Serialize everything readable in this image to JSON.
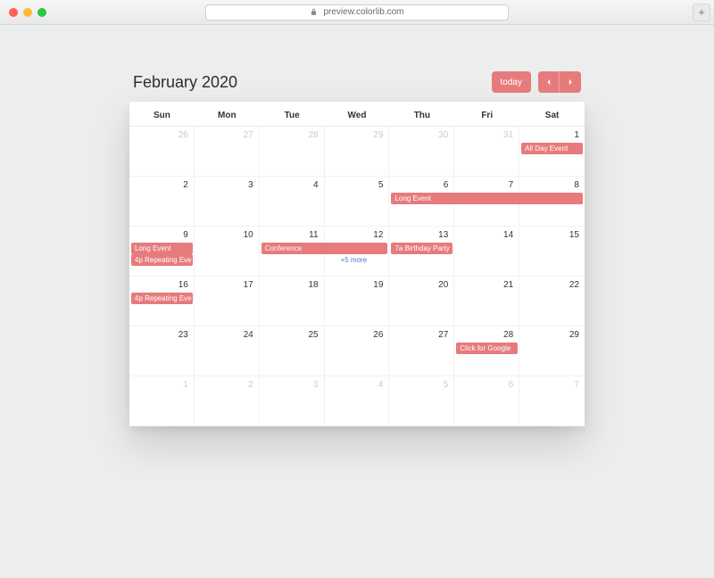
{
  "browser": {
    "url": "preview.colorlib.com"
  },
  "header": {
    "title": "February 2020",
    "today_label": "today"
  },
  "colors": {
    "accent": "#e77b7c"
  },
  "dow": [
    "Sun",
    "Mon",
    "Tue",
    "Wed",
    "Thu",
    "Fri",
    "Sat"
  ],
  "days": [
    {
      "n": "26",
      "other": true
    },
    {
      "n": "27",
      "other": true
    },
    {
      "n": "28",
      "other": true
    },
    {
      "n": "29",
      "other": true
    },
    {
      "n": "30",
      "other": true
    },
    {
      "n": "31",
      "other": true
    },
    {
      "n": "1"
    },
    {
      "n": "2"
    },
    {
      "n": "3"
    },
    {
      "n": "4"
    },
    {
      "n": "5"
    },
    {
      "n": "6"
    },
    {
      "n": "7"
    },
    {
      "n": "8"
    },
    {
      "n": "9"
    },
    {
      "n": "10"
    },
    {
      "n": "11"
    },
    {
      "n": "12"
    },
    {
      "n": "13"
    },
    {
      "n": "14"
    },
    {
      "n": "15"
    },
    {
      "n": "16"
    },
    {
      "n": "17"
    },
    {
      "n": "18"
    },
    {
      "n": "19"
    },
    {
      "n": "20"
    },
    {
      "n": "21"
    },
    {
      "n": "22"
    },
    {
      "n": "23"
    },
    {
      "n": "24"
    },
    {
      "n": "25"
    },
    {
      "n": "26"
    },
    {
      "n": "27"
    },
    {
      "n": "28"
    },
    {
      "n": "29"
    },
    {
      "n": "1",
      "other": true
    },
    {
      "n": "2",
      "other": true
    },
    {
      "n": "3",
      "other": true
    },
    {
      "n": "4",
      "other": true
    },
    {
      "n": "5",
      "other": true
    },
    {
      "n": "6",
      "other": true
    },
    {
      "n": "7",
      "other": true
    }
  ],
  "events": {
    "all_day": "All Day Event",
    "long_event_a": "Long Event",
    "long_event_b": "Long Event",
    "repeating_a": "4p Repeating Eve",
    "repeating_b": "4p Repeating Eve",
    "conference": "Conference",
    "birthday": "7a Birthday Party",
    "more": "+5 more",
    "google": "Click for Google"
  }
}
